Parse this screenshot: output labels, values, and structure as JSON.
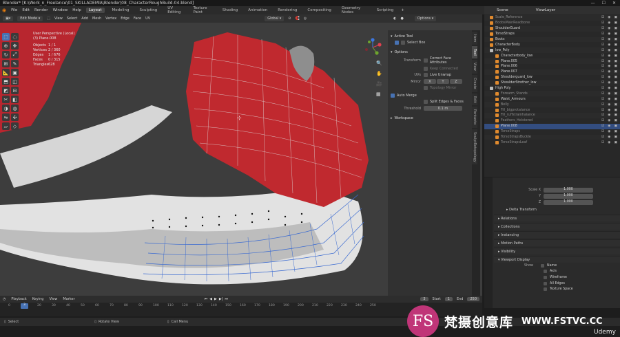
{
  "titlebar": {
    "title": "Blender* [K:\\Work_n_Freelance\\01_SKILLADEMIA\\Blender\\08_CharacterRoughBuild-04.blend]"
  },
  "menubar": {
    "menus": [
      "File",
      "Edit",
      "Render",
      "Window",
      "Help"
    ],
    "workspaces": [
      "Layout",
      "Modeling",
      "Sculpting",
      "UV Editing",
      "Texture Paint",
      "Shading",
      "Animation",
      "Rendering",
      "Compositing",
      "Geometry Nodes",
      "Scripting"
    ],
    "active_workspace": "Layout",
    "scene": "Scene",
    "view_layer": "ViewLayer"
  },
  "viewport_header": {
    "mode": "Edit Mode",
    "menus": [
      "View",
      "Select",
      "Add",
      "Mesh",
      "Vertex",
      "Edge",
      "Face",
      "UV"
    ],
    "orientation": "Global",
    "options": "Options"
  },
  "viewport_info": {
    "line1": "User Perspective (Local)",
    "line2": "(3) Plane.008",
    "stats": [
      {
        "k": "Objects",
        "v": "1 / 1"
      },
      {
        "k": "Vertices",
        "v": "2 / 360"
      },
      {
        "k": "Edges",
        "v": "1 / 676"
      },
      {
        "k": "Faces",
        "v": "0 / 315"
      },
      {
        "k": "Triangles",
        "v": "628"
      }
    ]
  },
  "npanel": {
    "active_tool_header": "Active Tool",
    "tool": "Select Box",
    "options_header": "Options",
    "transform_label": "Transform",
    "correct_face": "Correct Face Attributes",
    "keep_connected": "Keep Connected",
    "uvs_label": "UVs",
    "live_unwrap": "Live Unwrap",
    "mirror_label": "Mirror",
    "axes": [
      "X",
      "Y",
      "Z"
    ],
    "topology_mirror": "Topology Mirror",
    "auto_merge": "Auto Merge",
    "split_edges": "Split Edges & Faces",
    "threshold_label": "Threshold",
    "threshold_value": "0.1 m",
    "workspace": "Workspace"
  },
  "ntabs": [
    "Item",
    "Tool",
    "View",
    "Create",
    "Edit",
    "Pantanto",
    "SculptRetopology"
  ],
  "outliner": {
    "rows": [
      {
        "name": "Scale_Reference",
        "dim": true,
        "color": "#e08a2e"
      },
      {
        "name": "BoobsMainReadbone",
        "dim": true,
        "color": "#e08a2e"
      },
      {
        "name": "ShoulderGuard",
        "dim": false,
        "color": "#e08a2e"
      },
      {
        "name": "TorsoStraps",
        "dim": false,
        "color": "#e08a2e"
      },
      {
        "name": "Boots",
        "dim": false,
        "color": "#e08a2e"
      },
      {
        "name": "CharacterBody",
        "dim": false,
        "color": "#e08a2e"
      },
      {
        "name": "low_Poly",
        "dim": false,
        "color": "#bbbbbb"
      },
      {
        "name": "Characterbody_low",
        "dim": false,
        "color": "#e08a2e"
      },
      {
        "name": "Plane.005",
        "dim": false,
        "color": "#e08a2e"
      },
      {
        "name": "Plane.006",
        "dim": false,
        "color": "#e08a2e"
      },
      {
        "name": "Plane.007",
        "dim": false,
        "color": "#e08a2e"
      },
      {
        "name": "Shoulderguard_low",
        "dim": false,
        "color": "#e08a2e"
      },
      {
        "name": "ShoulderStrother_low",
        "dim": false,
        "color": "#e08a2e"
      },
      {
        "name": "High Poly",
        "dim": false,
        "color": "#bbbbbb"
      },
      {
        "name": "Forearm_Stands",
        "dim": true,
        "color": "#e08a2e"
      },
      {
        "name": "Waist_Armours",
        "dim": false,
        "color": "#e08a2e"
      },
      {
        "name": "Belly",
        "dim": true,
        "color": "#e08a2e"
      },
      {
        "name": "Fill_bigprotatance",
        "dim": true,
        "color": "#e08a2e"
      },
      {
        "name": "Fill_ruffstrainhalance",
        "dim": true,
        "color": "#e08a2e"
      },
      {
        "name": "Feathers_Holstered",
        "dim": true,
        "color": "#e08a2e"
      },
      {
        "name": "Plane.008",
        "dim": false,
        "color": "#e08a2e",
        "selected": true
      },
      {
        "name": "TorsoStraps",
        "dim": true,
        "color": "#e08a2e"
      },
      {
        "name": "TorsoStrapsBuckle",
        "dim": true,
        "color": "#e08a2e"
      },
      {
        "name": "TorsoStrapsLeaf",
        "dim": true,
        "color": "#e08a2e"
      }
    ]
  },
  "props": {
    "scale": [
      {
        "axis": "Scale X",
        "v": "1.000"
      },
      {
        "axis": "Y",
        "v": "1.000"
      },
      {
        "axis": "Z",
        "v": "1.000"
      }
    ],
    "sections": [
      "Delta Transform",
      "Relations",
      "Collections",
      "Instancing",
      "Motion Paths",
      "Visibility",
      "Viewport Display"
    ],
    "show_label": "Show",
    "show_items": [
      "Name",
      "Axis",
      "Wireframe",
      "All Edges",
      "Texture Space"
    ]
  },
  "timeline": {
    "menus": [
      "Playback",
      "Keying",
      "View",
      "Marker"
    ],
    "start_label": "Start",
    "start": "1",
    "end_label": "End",
    "end": "250",
    "current": "3",
    "ticks": [
      "0",
      "10",
      "20",
      "30",
      "40",
      "50",
      "60",
      "70",
      "80",
      "90",
      "100",
      "110",
      "120",
      "130",
      "140",
      "150",
      "160",
      "170",
      "180",
      "190",
      "200",
      "210",
      "220",
      "230",
      "240",
      "250"
    ]
  },
  "statusbar": {
    "items": [
      "Select",
      "Rotate View",
      "Call Menu"
    ]
  },
  "watermark": {
    "logo": "FS",
    "cn": "梵摄创意库",
    "url": "WWW.FSTVC.CC",
    "udemy": "Udemy"
  }
}
